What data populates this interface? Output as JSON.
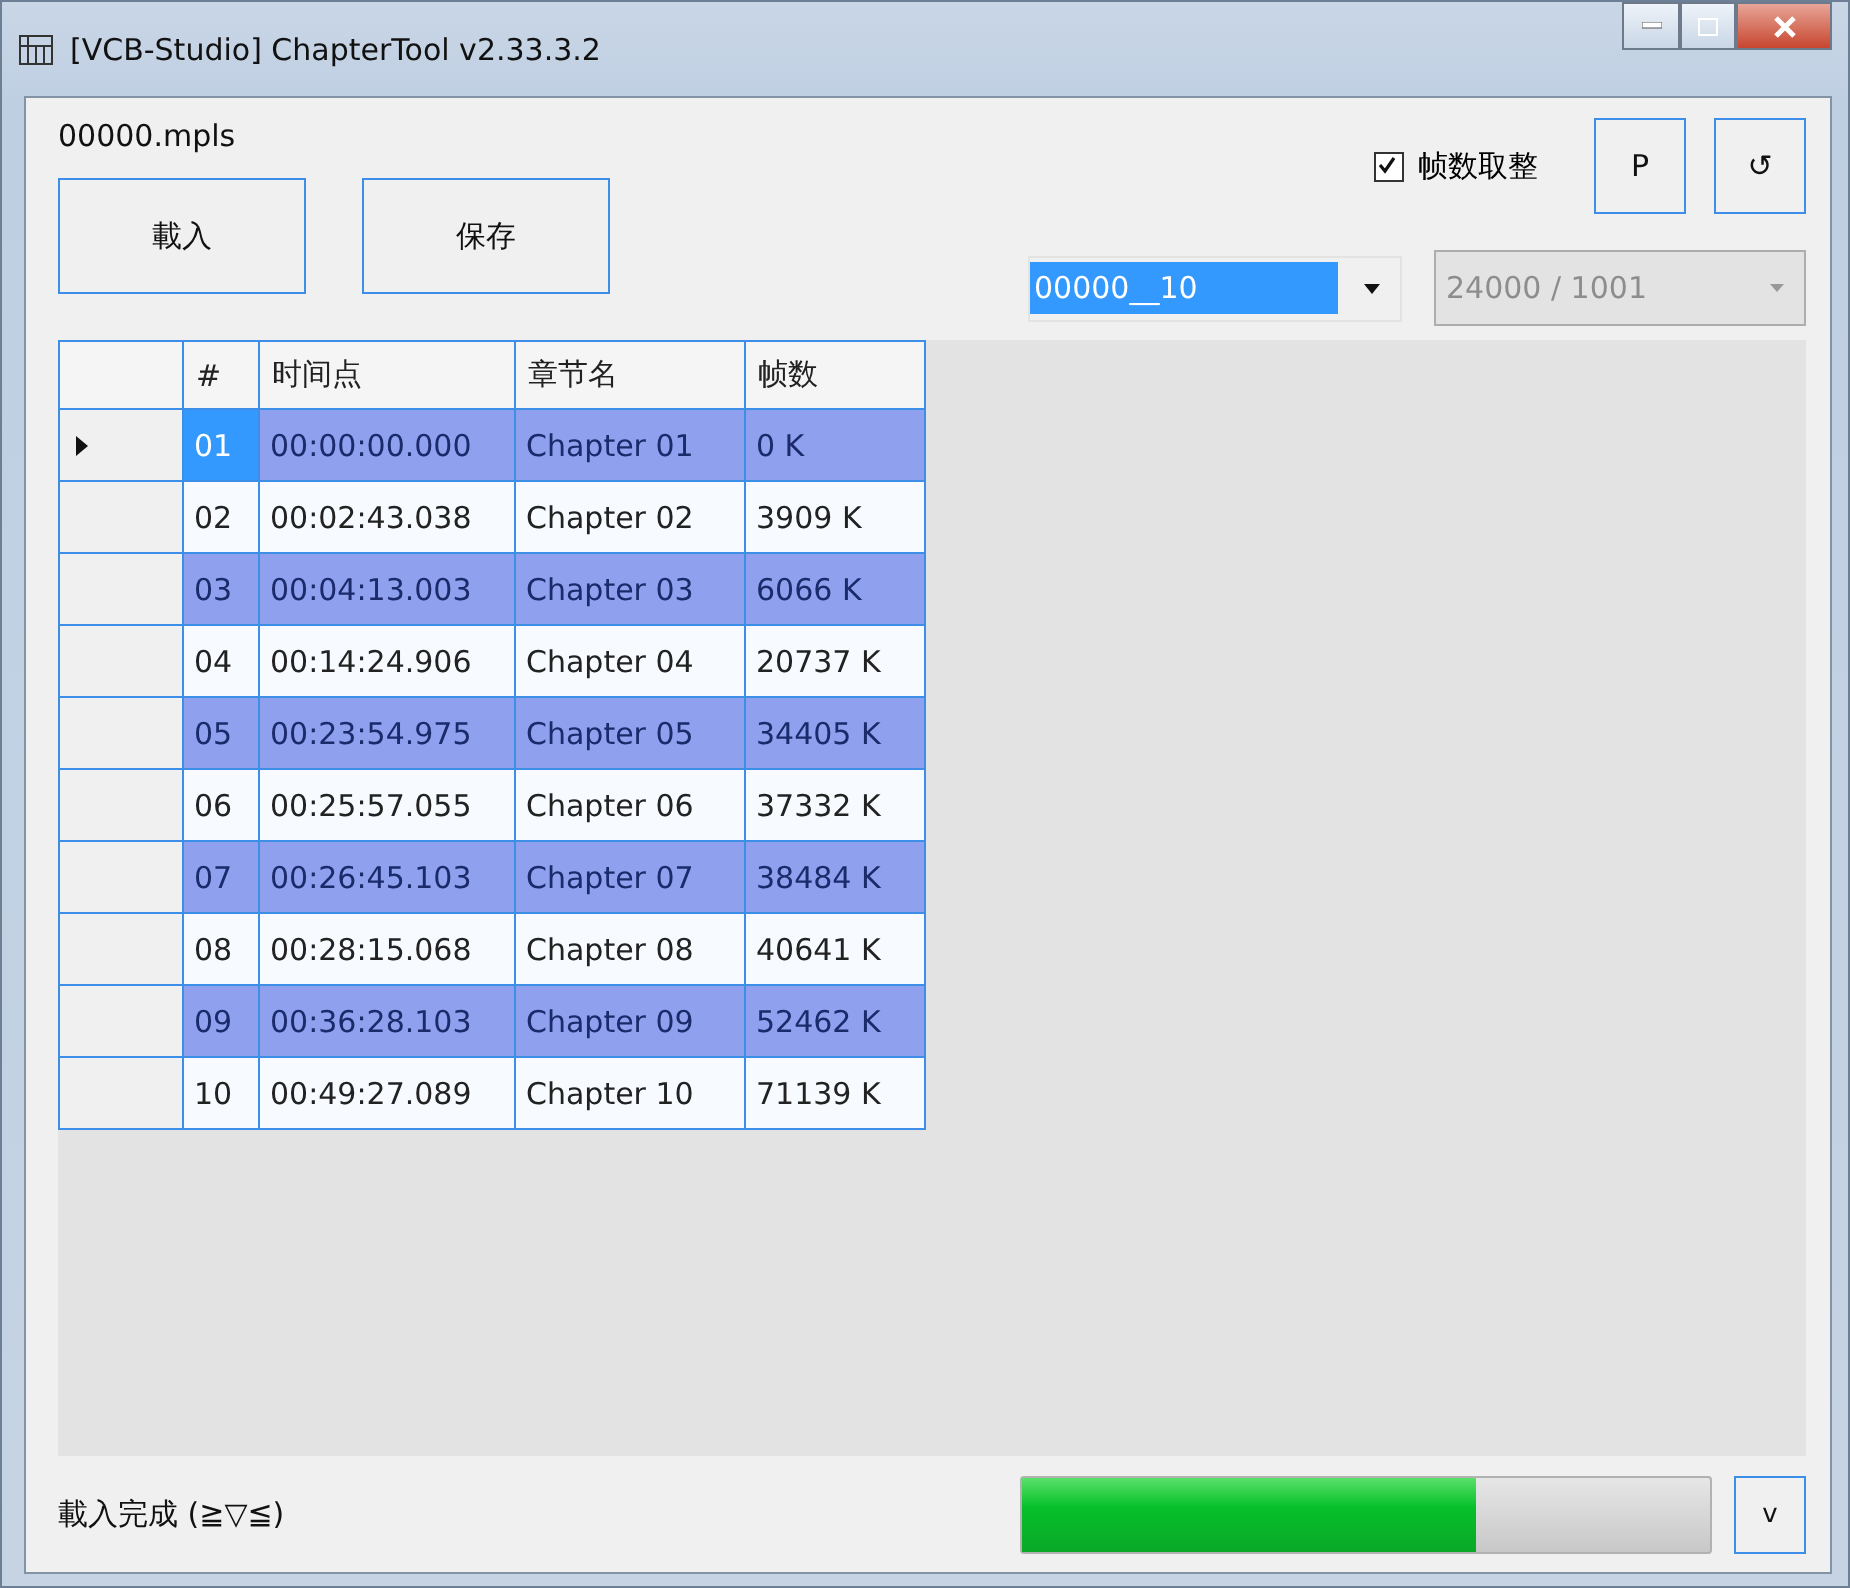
{
  "window": {
    "title": "[VCB-Studio] ChapterTool v2.33.3.2"
  },
  "file_name": "00000.mpls",
  "buttons": {
    "load": "載入",
    "save": "保存",
    "p": "P",
    "refresh": "↺",
    "expand": "v"
  },
  "round_frames": {
    "label": "帧数取整",
    "checked": true
  },
  "chapter_select": {
    "value": "00000__10"
  },
  "frame_rate": {
    "value": "24000 / 1001",
    "disabled": true
  },
  "table": {
    "columns": [
      "#",
      "时间点",
      "章节名",
      "帧数"
    ],
    "rows": [
      {
        "cells": [
          "01",
          "00:00:00.000",
          "Chapter 01",
          "0 K"
        ],
        "selected": true,
        "current": true
      },
      {
        "cells": [
          "02",
          "00:02:43.038",
          "Chapter 02",
          "3909 K"
        ],
        "selected": false,
        "current": false
      },
      {
        "cells": [
          "03",
          "00:04:13.003",
          "Chapter 03",
          "6066 K"
        ],
        "selected": true,
        "current": false
      },
      {
        "cells": [
          "04",
          "00:14:24.906",
          "Chapter 04",
          "20737 K"
        ],
        "selected": false,
        "current": false
      },
      {
        "cells": [
          "05",
          "00:23:54.975",
          "Chapter 05",
          "34405 K"
        ],
        "selected": true,
        "current": false
      },
      {
        "cells": [
          "06",
          "00:25:57.055",
          "Chapter 06",
          "37332 K"
        ],
        "selected": false,
        "current": false
      },
      {
        "cells": [
          "07",
          "00:26:45.103",
          "Chapter 07",
          "38484 K"
        ],
        "selected": true,
        "current": false
      },
      {
        "cells": [
          "08",
          "00:28:15.068",
          "Chapter 08",
          "40641 K"
        ],
        "selected": false,
        "current": false
      },
      {
        "cells": [
          "09",
          "00:36:28.103",
          "Chapter 09",
          "52462 K"
        ],
        "selected": true,
        "current": false
      },
      {
        "cells": [
          "10",
          "00:49:27.089",
          "Chapter 10",
          "71139 K"
        ],
        "selected": false,
        "current": false
      }
    ]
  },
  "status_bar": {
    "text": "載入完成 (≧▽≦)",
    "progress": {
      "level": 0.66
    }
  }
}
